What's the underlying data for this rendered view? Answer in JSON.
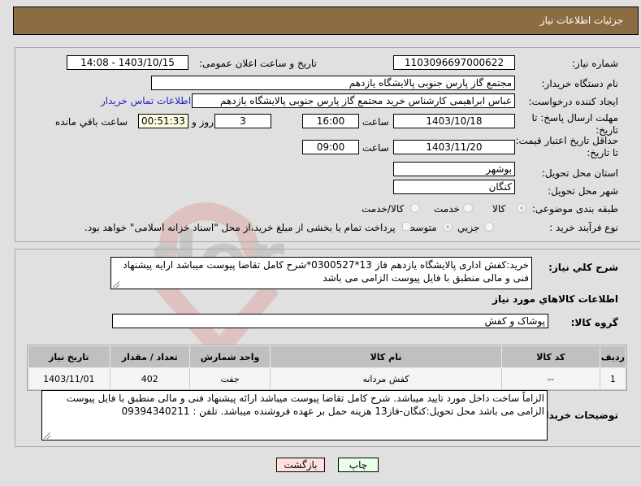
{
  "header": {
    "title": "جزئیات اطلاعات نیاز"
  },
  "fields": {
    "need_number_label": "شماره نیاز:",
    "need_number": "1103096697000622",
    "announce_label": "تاریخ و ساعت اعلان عمومی:",
    "announce_value": "1403/10/15 - 14:08",
    "buyer_org_label": "نام دستگاه خریدار:",
    "buyer_org": "مجتمع گاز پارس جنوبی  پالایشگاه یازدهم",
    "creator_label": "ایجاد کننده درخواست:",
    "creator": "عباس ابراهیمی کارشناس خرید مجتمع گاز پارس جنوبی  پالایشگاه یازدهم",
    "buyer_contact_link": "اطلاعات تماس خریدار",
    "deadline_label": "مهلت ارسال پاسخ: تا تاریخ:",
    "deadline_date": "1403/10/18",
    "time_label": "ساعت",
    "deadline_time": "16:00",
    "days_value": "3",
    "days_label": "روز و",
    "remaining_value": "00:51:33",
    "remaining_label": "ساعت باقي مانده",
    "price_valid_label": "حداقل تاریخ اعتبار قیمت: تا تاریخ:",
    "price_valid_date": "1403/11/20",
    "price_valid_time": "09:00",
    "province_label": "استان محل تحویل:",
    "province": "بوشهر",
    "city_label": "شهر محل تحویل:",
    "city": "کنگان",
    "category_label": "طبقه بندی موضوعی:",
    "category_options": [
      "کالا",
      "خدمت",
      "کالا/خدمت"
    ],
    "category_selected": "کالا",
    "process_label": "نوع فرآیند خرید :",
    "process_options": [
      "جزیي",
      "متوسط"
    ],
    "process_selected": "متوسط",
    "treasury_checkbox_label": "پرداخت تمام یا بخشی از مبلغ خرید،از محل \"اسناد خزانه اسلامی\" خواهد بود."
  },
  "summary": {
    "label": "شرح کلي نياز:",
    "text": "خرید:کفش اداری پالایشگاه یازدهم فاز 13*0300527*شرح کامل تقاضا پیوست میباشد ارایه پیشنهاد فنی و مالی منطبق با فایل پیوست الزامی می باشد"
  },
  "goods": {
    "section_title": "اطلاعات کالاهاي مورد نياز",
    "group_label": "گروه کالا:",
    "group_value": "پوشاک و کفش",
    "columns": [
      "ردیف",
      "کد کالا",
      "نام کالا",
      "واحد شمارش",
      "تعداد / مقدار",
      "تاریخ نیاز"
    ],
    "rows": [
      [
        "1",
        "--",
        "کفش مردانه",
        "جفت",
        "402",
        "1403/11/01"
      ]
    ]
  },
  "buyer_notes": {
    "label": "توضیحات خریدار:",
    "text": "الزاماً ساخت داخل مورد تایید میباشد. شرح کامل تقاضا پیوست میباشد ارائه پیشنهاد فنی و مالی منطبق با فایل پیوست الزامی می باشد محل تحویل:کنگان-فاز13 هزینه حمل بر عهده فروشنده میباشد. تلفن : 09394340211"
  },
  "buttons": {
    "print": "چاپ",
    "back": "بازگشت"
  },
  "colors": {
    "header_bg": "#8c6d43",
    "link": "#2323c8",
    "back_bg": "#ffe0e0",
    "print_bg": "#e8ffe8"
  }
}
